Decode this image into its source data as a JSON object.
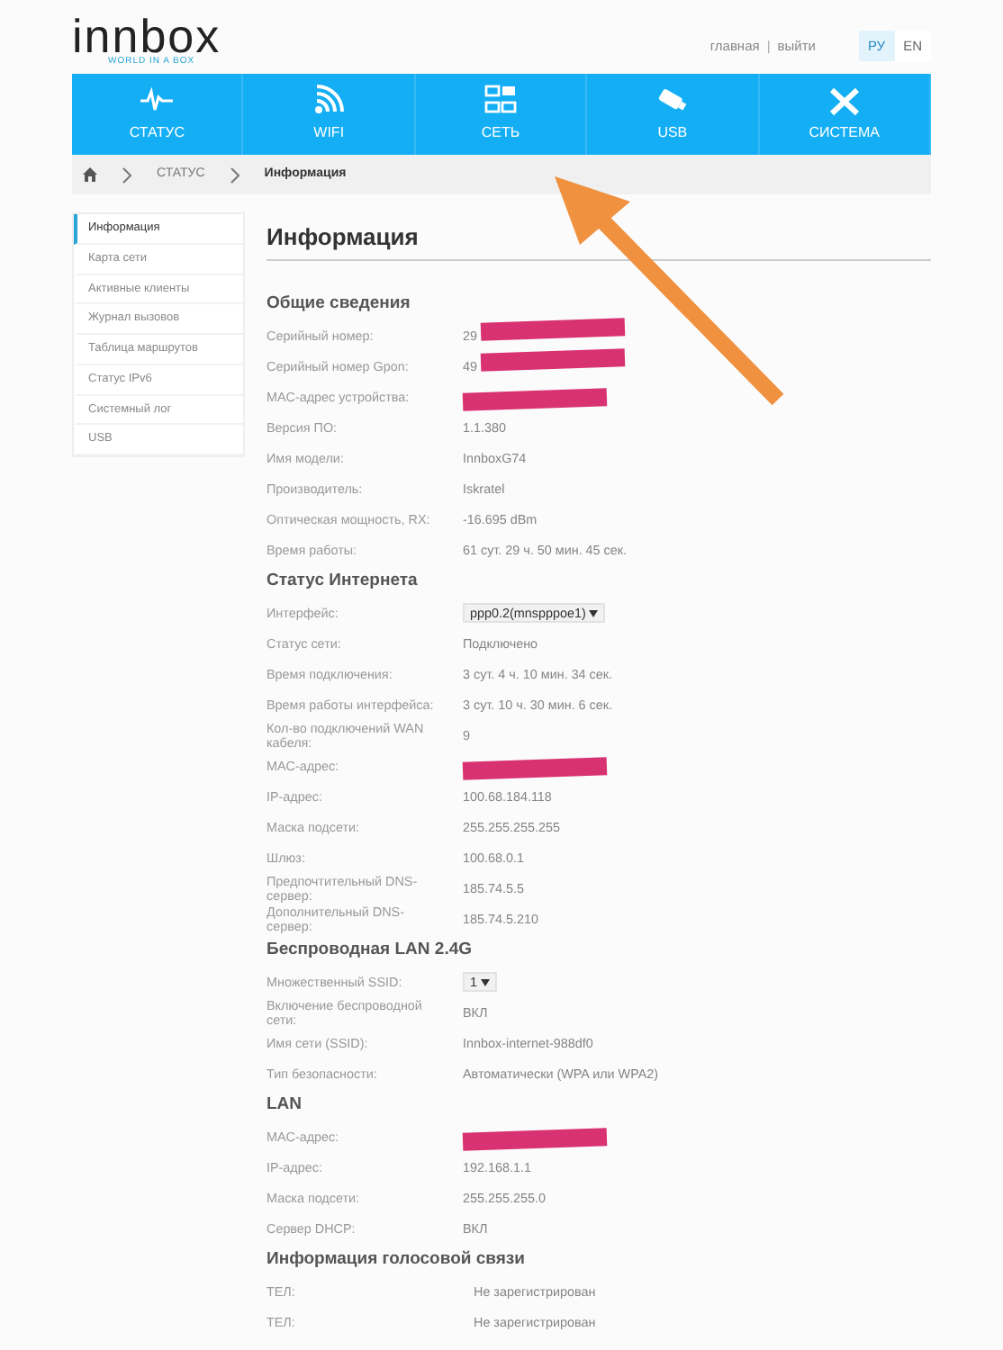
{
  "logo": {
    "name": "innbox",
    "tagline": "WORLD IN A BOX"
  },
  "top_links": [
    "главная",
    "выйти"
  ],
  "top_links_separator": "|",
  "languages": [
    {
      "label": "РУ",
      "selected": true
    },
    {
      "label": "EN",
      "selected": false
    }
  ],
  "nav": [
    {
      "label": "СТАТУС",
      "kind": "pulse"
    },
    {
      "label": "WIFI",
      "kind": "wifi"
    },
    {
      "label": "СЕТЬ",
      "kind": "network"
    },
    {
      "label": "USB",
      "kind": "usb"
    },
    {
      "label": "СИСТЕМА",
      "kind": "tools"
    }
  ],
  "breadcrumb": [
    "СТАТУС",
    "Информация"
  ],
  "sidebar": {
    "items": [
      {
        "label": "Информация",
        "selected": true
      },
      {
        "label": "Карта сети",
        "selected": false
      },
      {
        "label": "Активные клиенты",
        "selected": false
      },
      {
        "label": "Журнал вызовов",
        "selected": false
      },
      {
        "label": "Таблица маршрутов",
        "selected": false
      },
      {
        "label": "Статус IPv6",
        "selected": false
      },
      {
        "label": "Системный лог",
        "selected": false
      },
      {
        "label": "USB",
        "selected": false
      }
    ]
  },
  "title": "Информация",
  "sections": [
    {
      "title": "Общие сведения",
      "rows": [
        {
          "label": "Серийный номер:",
          "value": "29",
          "redacted": true
        },
        {
          "label": "Серийный номер Gpon:",
          "value": "49",
          "redacted": true
        },
        {
          "label": "MAC-адрес устройства:",
          "redacted": true
        },
        {
          "label": "Версия ПО:",
          "value": "1.1.380"
        },
        {
          "label": "Имя модели:",
          "value": "InnboxG74"
        },
        {
          "label": "Производитель:",
          "value": "Iskratel"
        },
        {
          "label": "Оптическая мощность, RX:",
          "value": "-16.695 dBm"
        },
        {
          "label": "Время работы:",
          "value": "61 сут. 29 ч. 50 мин. 45 сек."
        }
      ]
    },
    {
      "title": "Статус Интернета",
      "rows": [
        {
          "label": "Интерфейс:",
          "value": "ppp0.2(mnspppoe1)",
          "kind": "select"
        },
        {
          "label": "Статус сети:",
          "value": "Подключено"
        },
        {
          "label": "Время подключения:",
          "value": "3 сут. 4 ч. 10 мин. 34 сек."
        },
        {
          "label": "Время работы интерфейса:",
          "value": "3 сут. 10 ч. 30 мин. 6 сек."
        },
        {
          "label": "Кол-во подключений WAN кабеля:",
          "value": "9"
        },
        {
          "label": "MAC-адрес:",
          "redacted": true
        },
        {
          "label": "IP-адрес:",
          "value": "100.68.184.118"
        },
        {
          "label": "Маска подсети:",
          "value": "255.255.255.255"
        },
        {
          "label": "Шлюз:",
          "value": "100.68.0.1"
        },
        {
          "label": "Предпочтительный DNS-сервер:",
          "value": "185.74.5.5"
        },
        {
          "label": "Дополнительный DNS-сервер:",
          "value": "185.74.5.210"
        }
      ]
    },
    {
      "title": "Беспроводная LAN 2.4G",
      "rows": [
        {
          "label": "Множественный SSID:",
          "value": "1",
          "kind": "select"
        },
        {
          "label": "Включение беспроводной сети:",
          "value": "ВКЛ"
        },
        {
          "label": "Имя сети (SSID):",
          "value": "Innbox-internet-988df0"
        },
        {
          "label": "Тип безопасности:",
          "value": "Автоматически (WPA или WPA2)"
        }
      ]
    },
    {
      "title": "LAN",
      "rows": [
        {
          "label": "MAC-адрес:",
          "redacted": true
        },
        {
          "label": "IP-адрес:",
          "value": "192.168.1.1"
        },
        {
          "label": "Маска подсети:",
          "value": "255.255.255.0"
        },
        {
          "label": "Сервер DHCP:",
          "value": "ВКЛ"
        }
      ]
    },
    {
      "title": "Информация голосовой связи",
      "rows": [
        {
          "label": "ТЕЛ:",
          "value": "Не зарегистрирован",
          "kind": "indented"
        },
        {
          "label": "ТЕЛ:",
          "value": "Не зарегистрирован",
          "kind": "indented"
        }
      ]
    }
  ],
  "annotations": [
    {
      "kind": "arrow",
      "color": "#f0913f"
    }
  ]
}
